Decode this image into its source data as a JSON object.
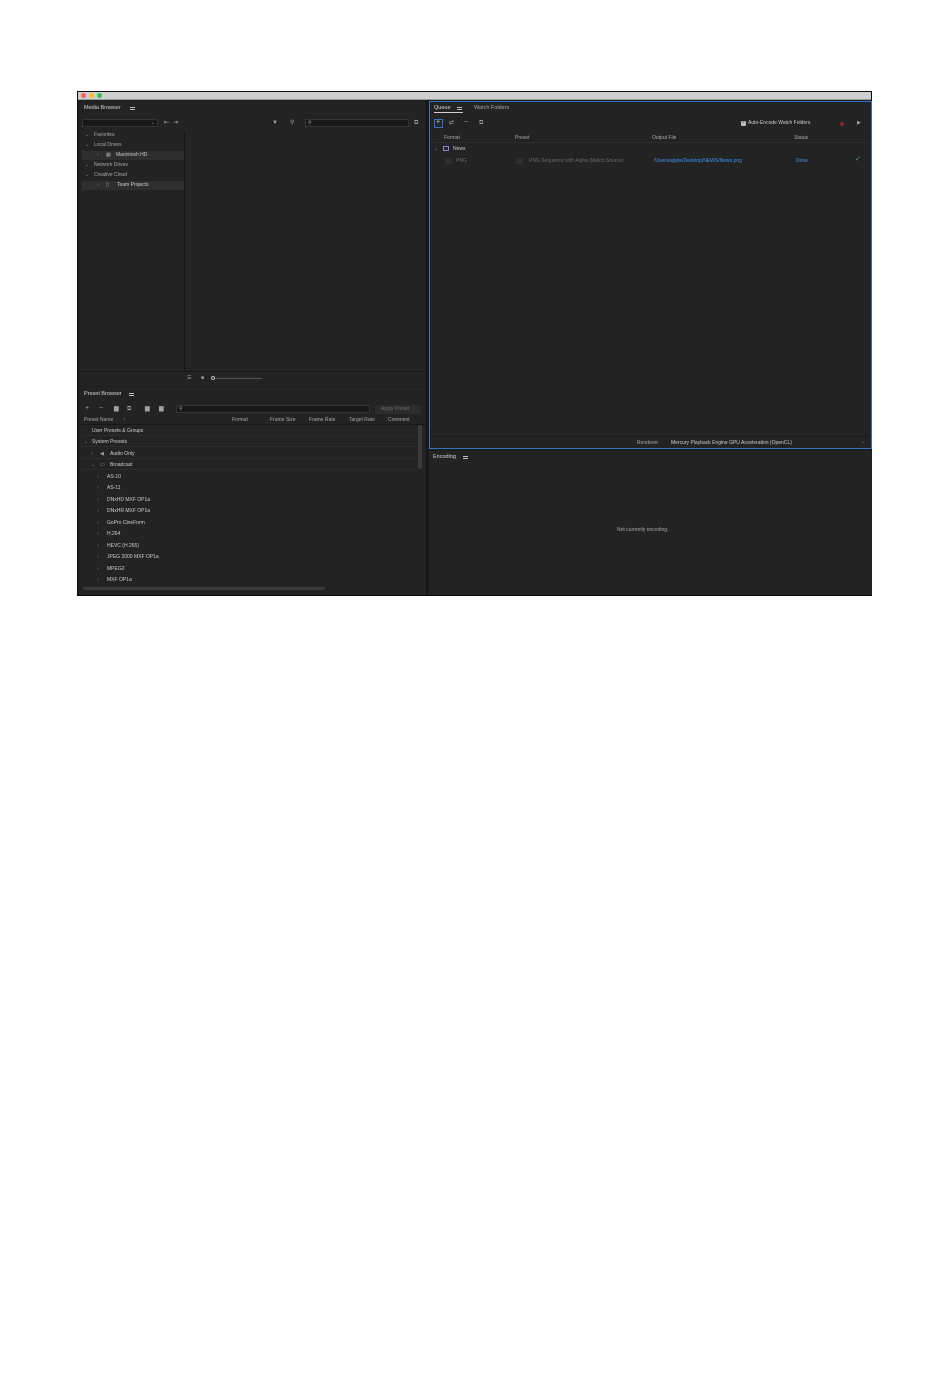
{
  "media_browser": {
    "title": "Media Browser",
    "tree": [
      {
        "label": "Favorites",
        "chev": "⌄"
      },
      {
        "label": "Local Drives",
        "chev": "⌄"
      },
      {
        "label": "Macintosh HD",
        "chev": "›"
      },
      {
        "label": "Network Drives",
        "chev": "⌄"
      },
      {
        "label": "Creative Cloud",
        "chev": "⌄"
      },
      {
        "label": "Team Projects",
        "chev": "›"
      }
    ]
  },
  "preset_browser": {
    "title": "Preset Browser",
    "apply_label": "Apply Preset",
    "columns": [
      "Preset Name",
      "Format",
      "Frame Size",
      "Frame Rate",
      "Target Rate",
      "Comment"
    ],
    "user_presets": "User Presets & Groups",
    "system_presets": "System Presets",
    "audio_only": "Audio Only",
    "broadcast": "Broadcast",
    "broadcast_items": [
      "AS-10",
      "AS-11",
      "DNxHD MXF OP1a",
      "DNxHR MXF OP1a",
      "GoPro CineForm",
      "H.264",
      "HEVC (H.265)",
      "JPEG 2000 MXF OP1a",
      "MPEG2",
      "MXF OP1a"
    ]
  },
  "queue": {
    "tab_queue": "Queue",
    "tab_watch": "Watch Folders",
    "auto_encode_label": "Auto-Encode Watch Folders",
    "columns": {
      "format": "Format",
      "preset": "Preset",
      "output": "Output File",
      "status": "Status"
    },
    "group_name": "News",
    "item": {
      "format": "PNG",
      "preset": "PNG Sequence with Alpha (Match Source)",
      "output": "/Users/apple/Desktop/NEWS/News.png",
      "status": "Done"
    },
    "renderer_label": "Renderer:",
    "renderer_value": "Mercury Playback Engine GPU Acceleration (OpenCL)"
  },
  "encoding": {
    "title": "Encoding",
    "message": "Not currently encoding."
  },
  "colors": {
    "accent_blue": "#3d95f2",
    "done_green": "#4caf50",
    "close_red": "#fc5f57",
    "minimize_yellow": "#fdbc2e",
    "zoom_green": "#29c840"
  }
}
